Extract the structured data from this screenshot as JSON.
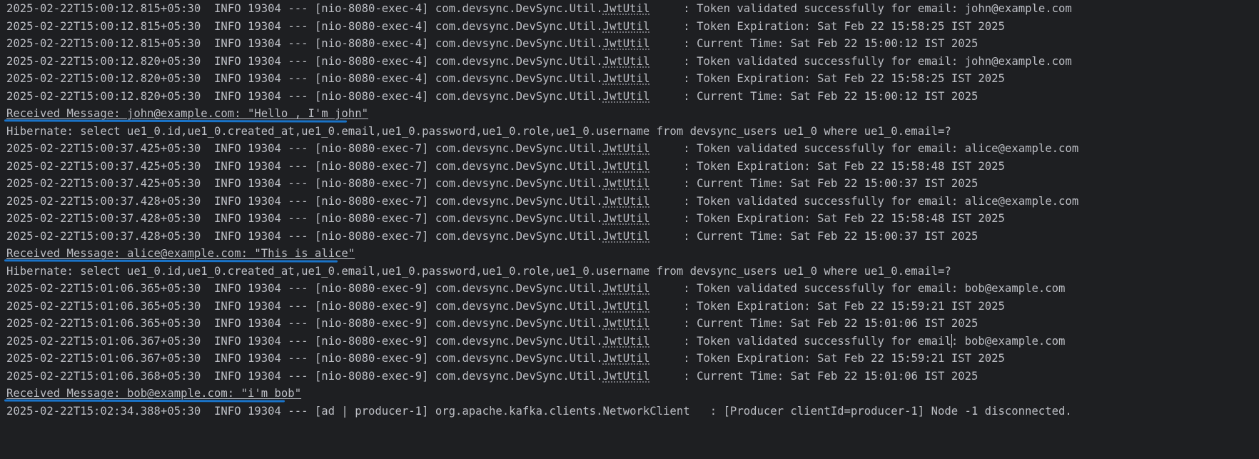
{
  "console": {
    "lines": [
      {
        "kind": "log",
        "ts": "2025-02-22T15:00:12.815+05:30",
        "level": "INFO",
        "pid": "19304",
        "sep": "---",
        "thread": "[nio-8080-exec-4]",
        "pkg": "com.devsync.DevSync.Util.",
        "cls": "JwtUtil",
        "msg": ": Token validated successfully for email: john@example.com"
      },
      {
        "kind": "log",
        "ts": "2025-02-22T15:00:12.815+05:30",
        "level": "INFO",
        "pid": "19304",
        "sep": "---",
        "thread": "[nio-8080-exec-4]",
        "pkg": "com.devsync.DevSync.Util.",
        "cls": "JwtUtil",
        "msg": ": Token Expiration: Sat Feb 22 15:58:25 IST 2025"
      },
      {
        "kind": "log",
        "ts": "2025-02-22T15:00:12.815+05:30",
        "level": "INFO",
        "pid": "19304",
        "sep": "---",
        "thread": "[nio-8080-exec-4]",
        "pkg": "com.devsync.DevSync.Util.",
        "cls": "JwtUtil",
        "msg": ": Current Time: Sat Feb 22 15:00:12 IST 2025"
      },
      {
        "kind": "log",
        "ts": "2025-02-22T15:00:12.820+05:30",
        "level": "INFO",
        "pid": "19304",
        "sep": "---",
        "thread": "[nio-8080-exec-4]",
        "pkg": "com.devsync.DevSync.Util.",
        "cls": "JwtUtil",
        "msg": ": Token validated successfully for email: john@example.com"
      },
      {
        "kind": "log",
        "ts": "2025-02-22T15:00:12.820+05:30",
        "level": "INFO",
        "pid": "19304",
        "sep": "---",
        "thread": "[nio-8080-exec-4]",
        "pkg": "com.devsync.DevSync.Util.",
        "cls": "JwtUtil",
        "msg": ": Token Expiration: Sat Feb 22 15:58:25 IST 2025"
      },
      {
        "kind": "log",
        "ts": "2025-02-22T15:00:12.820+05:30",
        "level": "INFO",
        "pid": "19304",
        "sep": "---",
        "thread": "[nio-8080-exec-4]",
        "pkg": "com.devsync.DevSync.Util.",
        "cls": "JwtUtil",
        "msg": ": Current Time: Sat Feb 22 15:00:12 IST 2025"
      },
      {
        "kind": "message",
        "text": "Received Message: john@example.com: \"Hello , I'm john\""
      },
      {
        "kind": "plain",
        "text": "Hibernate: select ue1_0.id,ue1_0.created_at,ue1_0.email,ue1_0.password,ue1_0.role,ue1_0.username from devsync_users ue1_0 where ue1_0.email=?"
      },
      {
        "kind": "log",
        "ts": "2025-02-22T15:00:37.425+05:30",
        "level": "INFO",
        "pid": "19304",
        "sep": "---",
        "thread": "[nio-8080-exec-7]",
        "pkg": "com.devsync.DevSync.Util.",
        "cls": "JwtUtil",
        "msg": ": Token validated successfully for email: alice@example.com"
      },
      {
        "kind": "log",
        "ts": "2025-02-22T15:00:37.425+05:30",
        "level": "INFO",
        "pid": "19304",
        "sep": "---",
        "thread": "[nio-8080-exec-7]",
        "pkg": "com.devsync.DevSync.Util.",
        "cls": "JwtUtil",
        "msg": ": Token Expiration: Sat Feb 22 15:58:48 IST 2025"
      },
      {
        "kind": "log",
        "ts": "2025-02-22T15:00:37.425+05:30",
        "level": "INFO",
        "pid": "19304",
        "sep": "---",
        "thread": "[nio-8080-exec-7]",
        "pkg": "com.devsync.DevSync.Util.",
        "cls": "JwtUtil",
        "msg": ": Current Time: Sat Feb 22 15:00:37 IST 2025"
      },
      {
        "kind": "log",
        "ts": "2025-02-22T15:00:37.428+05:30",
        "level": "INFO",
        "pid": "19304",
        "sep": "---",
        "thread": "[nio-8080-exec-7]",
        "pkg": "com.devsync.DevSync.Util.",
        "cls": "JwtUtil",
        "msg": ": Token validated successfully for email: alice@example.com"
      },
      {
        "kind": "log",
        "ts": "2025-02-22T15:00:37.428+05:30",
        "level": "INFO",
        "pid": "19304",
        "sep": "---",
        "thread": "[nio-8080-exec-7]",
        "pkg": "com.devsync.DevSync.Util.",
        "cls": "JwtUtil",
        "msg": ": Token Expiration: Sat Feb 22 15:58:48 IST 2025"
      },
      {
        "kind": "log",
        "ts": "2025-02-22T15:00:37.428+05:30",
        "level": "INFO",
        "pid": "19304",
        "sep": "---",
        "thread": "[nio-8080-exec-7]",
        "pkg": "com.devsync.DevSync.Util.",
        "cls": "JwtUtil",
        "msg": ": Current Time: Sat Feb 22 15:00:37 IST 2025"
      },
      {
        "kind": "message",
        "text": "Received Message: alice@example.com: \"This is alice\""
      },
      {
        "kind": "plain",
        "text": "Hibernate: select ue1_0.id,ue1_0.created_at,ue1_0.email,ue1_0.password,ue1_0.role,ue1_0.username from devsync_users ue1_0 where ue1_0.email=?"
      },
      {
        "kind": "log",
        "ts": "2025-02-22T15:01:06.365+05:30",
        "level": "INFO",
        "pid": "19304",
        "sep": "---",
        "thread": "[nio-8080-exec-9]",
        "pkg": "com.devsync.DevSync.Util.",
        "cls": "JwtUtil",
        "msg": ": Token validated successfully for email: bob@example.com"
      },
      {
        "kind": "log",
        "ts": "2025-02-22T15:01:06.365+05:30",
        "level": "INFO",
        "pid": "19304",
        "sep": "---",
        "thread": "[nio-8080-exec-9]",
        "pkg": "com.devsync.DevSync.Util.",
        "cls": "JwtUtil",
        "msg": ": Token Expiration: Sat Feb 22 15:59:21 IST 2025"
      },
      {
        "kind": "log",
        "ts": "2025-02-22T15:01:06.365+05:30",
        "level": "INFO",
        "pid": "19304",
        "sep": "---",
        "thread": "[nio-8080-exec-9]",
        "pkg": "com.devsync.DevSync.Util.",
        "cls": "JwtUtil",
        "msg": ": Current Time: Sat Feb 22 15:01:06 IST 2025"
      },
      {
        "kind": "log",
        "ts": "2025-02-22T15:01:06.367+05:30",
        "level": "INFO",
        "pid": "19304",
        "sep": "---",
        "thread": "[nio-8080-exec-9]",
        "pkg": "com.devsync.DevSync.Util.",
        "cls": "JwtUtil",
        "msg": ": Token validated successfully for email: bob@example.com"
      },
      {
        "kind": "log",
        "ts": "2025-02-22T15:01:06.367+05:30",
        "level": "INFO",
        "pid": "19304",
        "sep": "---",
        "thread": "[nio-8080-exec-9]",
        "pkg": "com.devsync.DevSync.Util.",
        "cls": "JwtUtil",
        "msg": ": Token Expiration: Sat Feb 22 15:59:21 IST 2025"
      },
      {
        "kind": "log",
        "ts": "2025-02-22T15:01:06.368+05:30",
        "level": "INFO",
        "pid": "19304",
        "sep": "---",
        "thread": "[nio-8080-exec-9]",
        "pkg": "com.devsync.DevSync.Util.",
        "cls": "JwtUtil",
        "msg": ": Current Time: Sat Feb 22 15:01:06 IST 2025"
      },
      {
        "kind": "message",
        "text": "Received Message: bob@example.com: \"i'm bob\""
      },
      {
        "kind": "partial",
        "text": "2025-02-22T15:02:34.388+05:30  INFO 19304 --- [ad | producer-1] org.apache.kafka.clients.NetworkClient   : [Producer clientId=producer-1] Node -1 disconnected."
      }
    ]
  }
}
